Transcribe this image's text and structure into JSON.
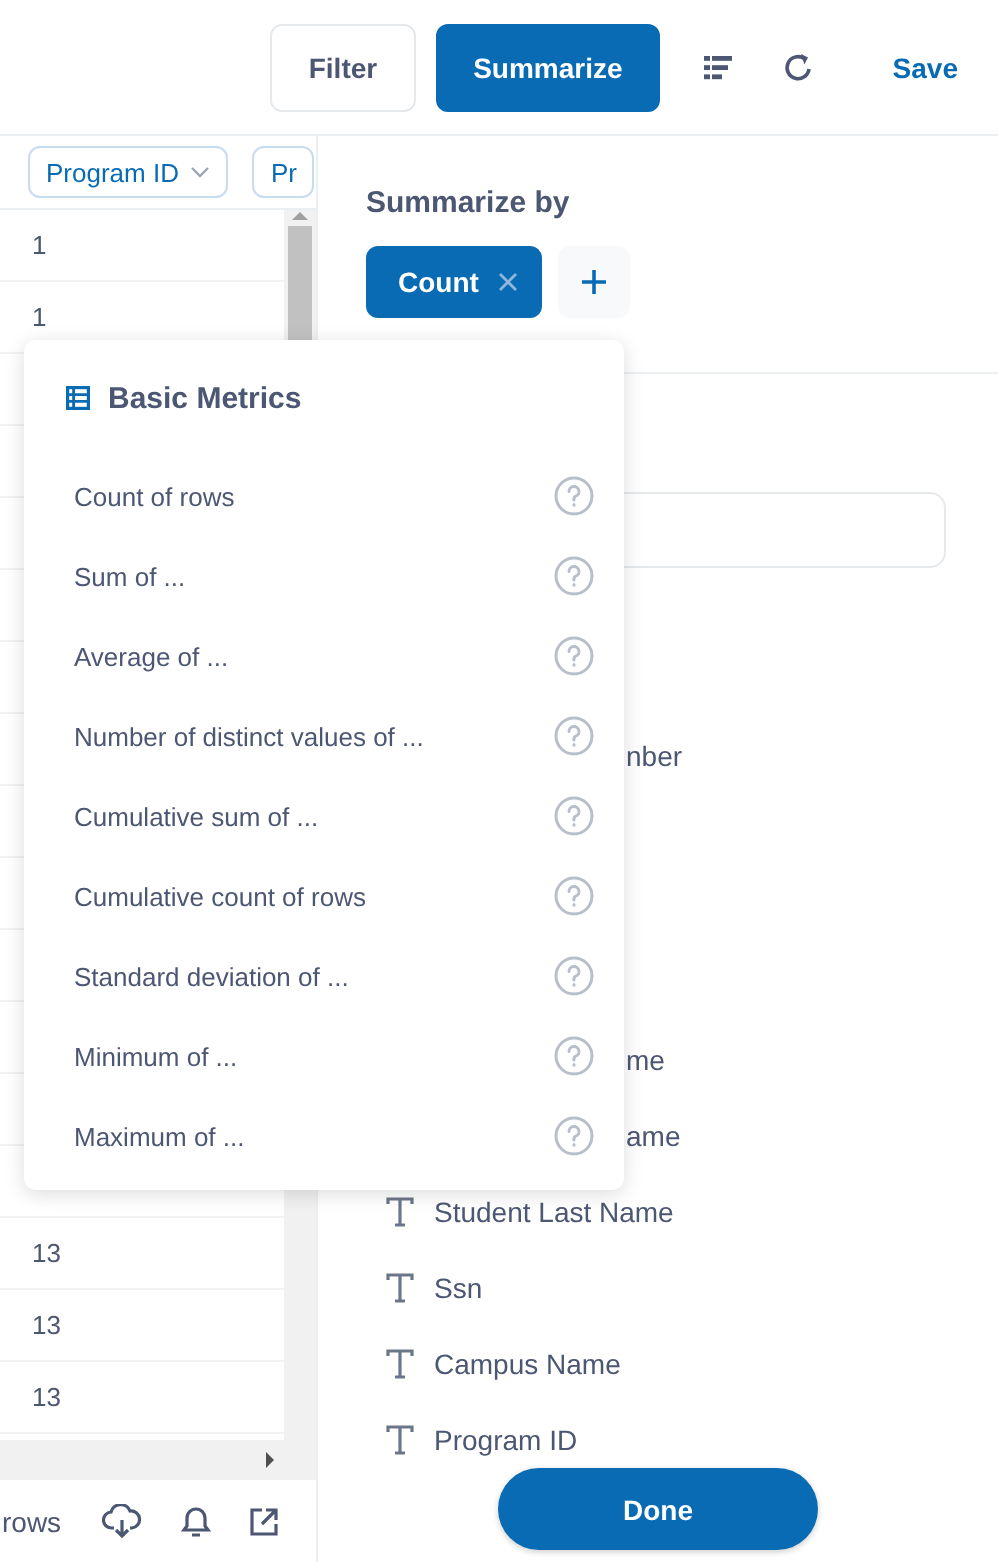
{
  "toolbar": {
    "filter": "Filter",
    "summarize": "Summarize",
    "save": "Save"
  },
  "table": {
    "columns": [
      {
        "label": "Program ID"
      },
      {
        "label": "Pr"
      }
    ],
    "rows_top": [
      {
        "program_id": "1"
      },
      {
        "program_id": "1"
      }
    ],
    "rows_bottom": [
      {
        "program_id": "13"
      },
      {
        "program_id": "13"
      },
      {
        "program_id": "13"
      }
    ],
    "footer": {
      "rows_text": "rows"
    }
  },
  "summarize_panel": {
    "title": "Summarize by",
    "metric_chip": "Count",
    "fields": [
      {
        "kind": "partial",
        "label": "nber"
      },
      {
        "kind": "partial",
        "label": "me"
      },
      {
        "kind": "partial",
        "label": "ame"
      },
      {
        "kind": "text",
        "label": "Student Last Name"
      },
      {
        "kind": "text",
        "label": "Ssn"
      },
      {
        "kind": "text",
        "label": "Campus Name"
      },
      {
        "kind": "text",
        "label": "Program ID"
      }
    ],
    "done": "Done"
  },
  "popover": {
    "title": "Basic Metrics",
    "items": [
      {
        "label": "Count of rows"
      },
      {
        "label": "Sum of ..."
      },
      {
        "label": "Average of ..."
      },
      {
        "label": "Number of distinct values of ..."
      },
      {
        "label": "Cumulative sum of ..."
      },
      {
        "label": "Cumulative count of rows"
      },
      {
        "label": "Standard deviation of ..."
      },
      {
        "label": "Minimum of ..."
      },
      {
        "label": "Maximum of ..."
      }
    ]
  }
}
